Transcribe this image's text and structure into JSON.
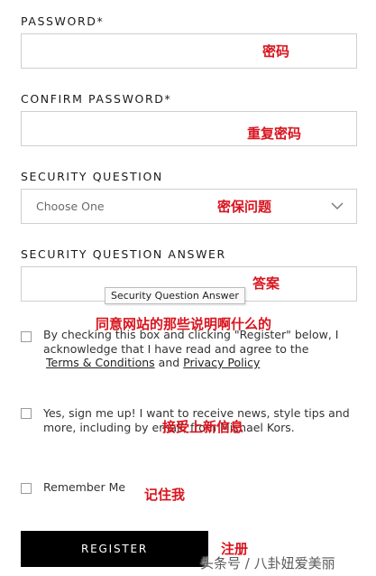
{
  "form": {
    "password_label": "PASSWORD*",
    "confirm_password_label": "CONFIRM PASSWORD*",
    "security_question_label": "SECURITY QUESTION",
    "security_question_value": "Choose One",
    "security_answer_label": "SECURITY QUESTION ANSWER",
    "security_answer_tooltip": "Security Question Answer",
    "terms": {
      "text_before": "By checking this box and clicking \"Register\" below, I acknowledge that I have read and agree to the",
      "terms_link": "Terms & Conditions",
      "and": "and",
      "privacy_link": "Privacy Policy"
    },
    "newsletter_text": "Yes, sign me up! I want to receive news, style tips and more, including by email, from Michael Kors.",
    "remember_me_label": "Remember Me",
    "register_button": "REGISTER"
  },
  "annotations": {
    "password": "密码",
    "confirm_password": "重复密码",
    "security_question": "密保问题",
    "security_answer": "答案",
    "terms": "同意网站的那些说明啊什么的",
    "newsletter": "接受上新信息",
    "remember_me": "记住我",
    "register": "注册"
  },
  "watermark": "头条号 / 八卦妞爱美丽",
  "colors": {
    "annotation": "#d9141e",
    "button_bg": "#000000",
    "field_border": "#cfcfcf"
  }
}
